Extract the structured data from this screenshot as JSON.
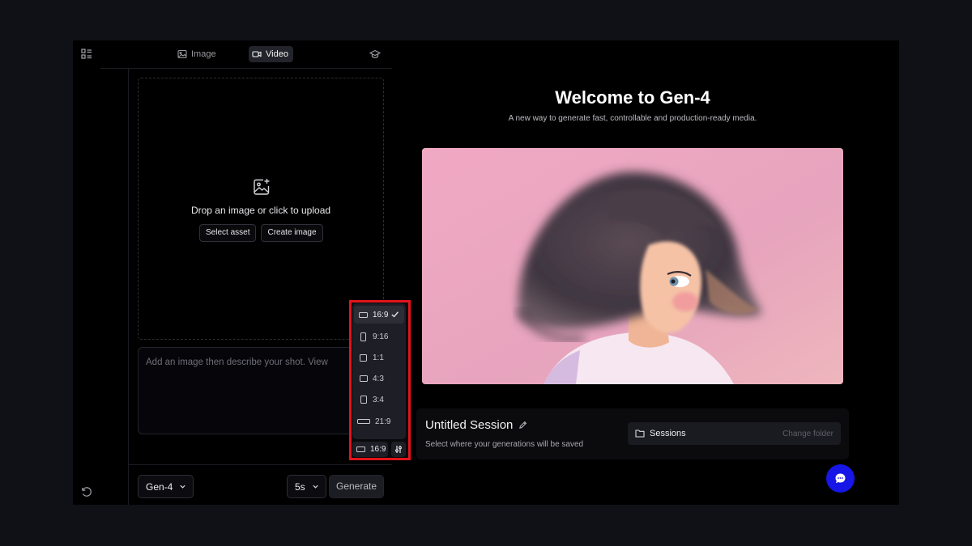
{
  "rail": {
    "top_icon": "grid-list-icon",
    "bottom_icon": "history-icon"
  },
  "tabs": [
    {
      "label": "Image",
      "icon": "image-icon",
      "active": false
    },
    {
      "label": "Video",
      "icon": "video-camera-icon",
      "active": true
    }
  ],
  "topbar": {
    "right_icon": "graduation-cap-icon"
  },
  "upload": {
    "text": "Drop an image or click to upload",
    "select_asset_label": "Select asset",
    "create_image_label": "Create image"
  },
  "prompt": {
    "placeholder": "Add an image then describe your shot. View"
  },
  "aspect_menu": {
    "options": [
      "16:9",
      "9:16",
      "1:1",
      "4:3",
      "3:4",
      "21:9"
    ],
    "selected": "16:9",
    "current_label": "16:9"
  },
  "bottom_bar": {
    "model_label": "Gen-4",
    "duration_label": "5s",
    "generate_label": "Generate"
  },
  "welcome": {
    "title": "Welcome to Gen-4",
    "subtitle": "A new way to generate fast, controllable and production-ready media."
  },
  "session": {
    "title": "Untitled Session",
    "subtitle": "Select where your generations will be saved",
    "folder_label": "Sessions",
    "change_folder_label": "Change folder"
  },
  "colors": {
    "page_bg": "#101117",
    "app_bg": "#000000",
    "highlight": "#e3141b",
    "chat_button": "#1616e6",
    "hero_bg": "#e7a4bd"
  }
}
